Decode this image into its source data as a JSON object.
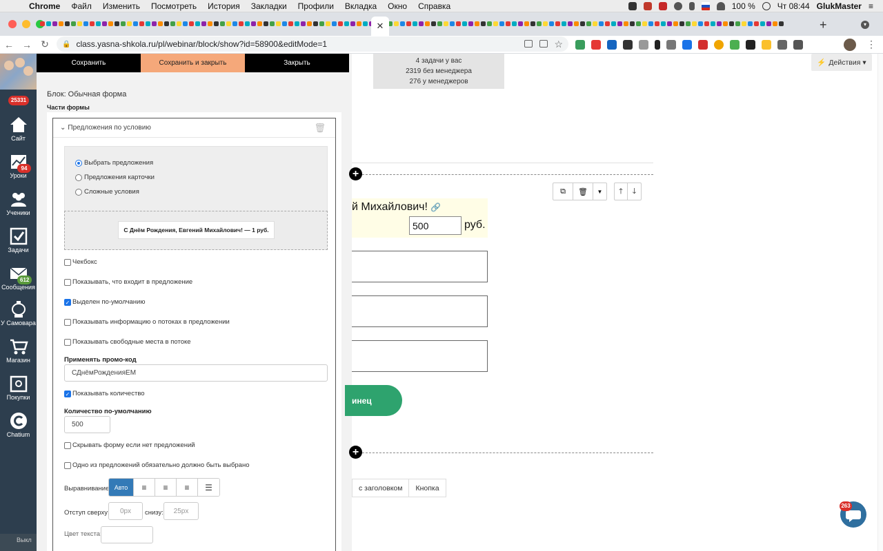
{
  "menubar": {
    "app": "Chrome",
    "items": [
      "Файл",
      "Изменить",
      "Посмотреть",
      "История",
      "Закладки",
      "Профили",
      "Вкладка",
      "Окно",
      "Справка"
    ],
    "battery": "100 %",
    "clock": "Чт 08:44",
    "user": "GlukMaster"
  },
  "browser": {
    "url": "class.yasna-shkola.ru/pl/webinar/block/show?id=58900&editMode=1",
    "active_tab_close": "✕",
    "new_tab": "+"
  },
  "appnav": {
    "top_badge": "25331",
    "items": [
      {
        "label": "Сайт",
        "badge": ""
      },
      {
        "label": "Уроки",
        "badge": "94"
      },
      {
        "label": "Ученики",
        "badge": ""
      },
      {
        "label": "Задачи",
        "badge": ""
      },
      {
        "label": "Сообщения",
        "badge": "612"
      },
      {
        "label": "У Самовара",
        "badge": ""
      },
      {
        "label": "Магазин",
        "badge": ""
      },
      {
        "label": "Покупки",
        "badge": ""
      },
      {
        "label": "Chatium",
        "badge": ""
      }
    ],
    "bottom_text": "Выкл"
  },
  "panel": {
    "save": "Сохранить",
    "save_close": "Сохранить и закрыть",
    "close": "Закрыть",
    "block_title": "Блок: Обычная форма",
    "parts_title": "Части формы",
    "part_name": "Предложения по условию",
    "radios": [
      "Выбрать предложения",
      "Предложения карточки",
      "Сложные условия"
    ],
    "offer_chip": "С Днём Рождения, Евгений Михайлович! — 1 руб.",
    "checkboxes": [
      {
        "label": "Чекбокс",
        "checked": false
      },
      {
        "label": "Показывать, что входит в предложение",
        "checked": false
      },
      {
        "label": "Выделен по-умолчанию",
        "checked": true
      },
      {
        "label": "Показывать информацию о потоках в предложении",
        "checked": false
      },
      {
        "label": "Показывать свободные места в потоке",
        "checked": false
      }
    ],
    "promo_label": "Применять промо-код",
    "promo_value": "СДнёмРожденияЕМ",
    "show_qty": "Показывать количество",
    "qty_label": "Количество по-умолчанию",
    "qty_value": "500",
    "hide_form": "Скрывать форму если нет предложений",
    "one_required": "Одно из предложений обязательно должно быть выбрано",
    "align_label": "Выравнивание",
    "align_auto": "Авто",
    "pad_top_label": "Отступ сверху:",
    "pad_top_placeholder": "0px",
    "pad_bottom_label": "снизу:",
    "pad_bottom_placeholder": "25px",
    "color_label": "Цвет текста:"
  },
  "canvas": {
    "stats": [
      "4 задачи у вас",
      "2319 без менеджера",
      "276 у менеджеров"
    ],
    "actions": "Действия",
    "greeting": "й Михайлович!",
    "qty": "500",
    "currency": "руб.",
    "button_text": "инец",
    "add_tabs": [
      "с заголовком",
      "Кнопка"
    ],
    "chat_badge": "263"
  }
}
